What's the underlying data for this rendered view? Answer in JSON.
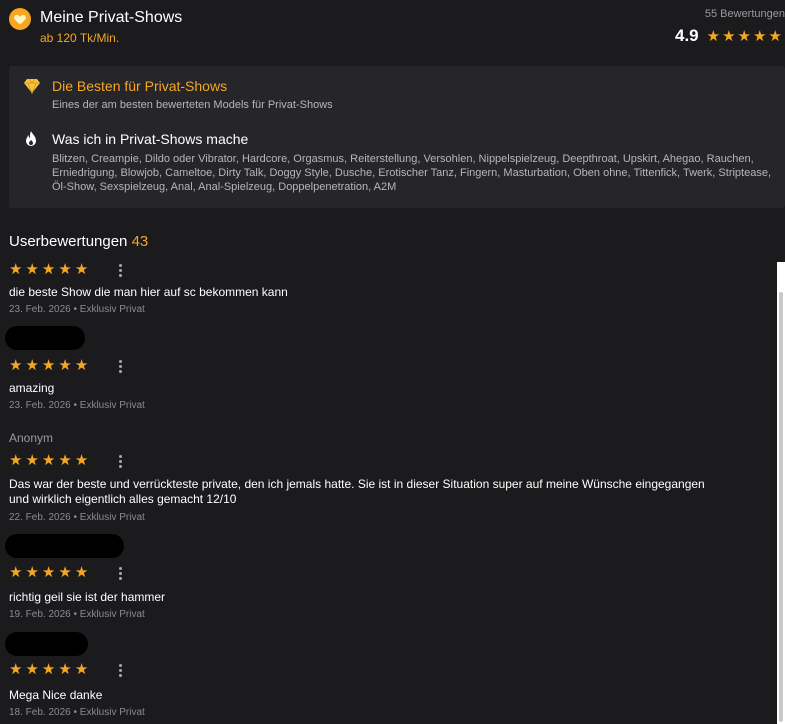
{
  "header": {
    "title": "Meine Privat-Shows",
    "price": "ab 120 Tk/Min.",
    "rating_count": "55 Bewertungen",
    "rating_value": "4.9"
  },
  "features": {
    "best": {
      "title": "Die Besten für Privat-Shows",
      "subtitle": "Eines der am besten bewerteten Models für Privat-Shows"
    },
    "activities": {
      "title": "Was ich in Privat-Shows mache",
      "tags": "Blitzen, Creampie, Dildo oder Vibrator, Hardcore, Orgasmus, Reiterstellung, Versohlen, Nippelspielzeug, Deepthroat, Upskirt, Ahegao, Rauchen, Erniedrigung, Blowjob, Cameltoe, Dirty Talk, Doggy Style, Dusche, Erotischer Tanz, Fingern, Masturbation, Oben ohne, Tittenfick, Twerk, Striptease, Öl-Show, Sexspielzeug, Anal, Anal-Spielzeug, Doppelpenetration, A2M"
    }
  },
  "reviews": {
    "title": "Userbewertungen",
    "count": "43",
    "items": [
      {
        "author": "",
        "stars": 5,
        "text": "die beste Show die man hier auf sc bekommen kann",
        "meta": "23. Feb. 2026 • Exklusiv Privat"
      },
      {
        "author": "",
        "stars": 5,
        "text": "amazing",
        "meta": "23. Feb. 2026 • Exklusiv Privat"
      },
      {
        "author": "Anonym",
        "stars": 5,
        "text": "Das war der beste und verrückteste private, den ich jemals hatte. Sie ist in dieser Situation super auf meine Wünsche eingegangen und wirklich eigentlich alles gemacht 12/10",
        "meta": "22. Feb. 2026 • Exklusiv Privat"
      },
      {
        "author": "",
        "stars": 5,
        "text": "richtig geil sie ist der hammer",
        "meta": "19. Feb. 2026 • Exklusiv Privat"
      },
      {
        "author": "",
        "stars": 5,
        "text": "Mega Nice danke",
        "meta": "18. Feb. 2026 • Exklusiv Privat"
      }
    ]
  },
  "colors": {
    "accent": "#f5a623",
    "background": "#1b1b1e",
    "panel": "#26262a"
  },
  "icons": {
    "coin": "heart-coin-icon",
    "best": "diamond-icon",
    "activities": "flame-icon",
    "star": "star-icon",
    "more": "more-vertical-icon"
  }
}
